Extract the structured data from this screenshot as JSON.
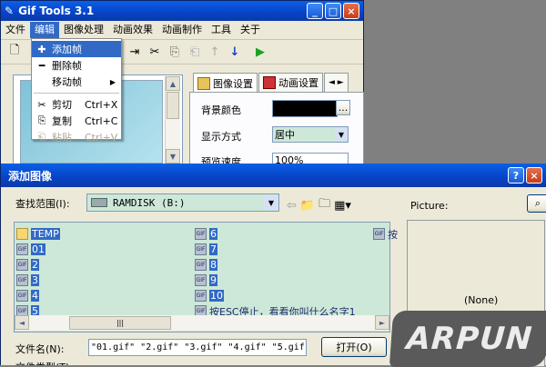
{
  "main_window": {
    "title": "Gif Tools 3.1",
    "controls": {
      "minimize": "_",
      "maximize": "□",
      "close": "×"
    },
    "menu": [
      "文件",
      "编辑",
      "图像处理",
      "动画效果",
      "动画制作",
      "工具",
      "关于"
    ],
    "active_menu_index": 1,
    "edit_menu": {
      "items": [
        {
          "label": "添加帧",
          "icon": "add-frame-icon",
          "highlighted": true
        },
        {
          "label": "删除帧",
          "icon": "delete-frame-icon"
        },
        {
          "label": "移动帧",
          "submenu": true
        },
        {
          "label": "剪切",
          "shortcut": "Ctrl+X",
          "icon": "scissors-icon"
        },
        {
          "label": "复制",
          "shortcut": "Ctrl+C",
          "icon": "copy-icon"
        },
        {
          "label": "粘贴",
          "shortcut": "Ctrl+V",
          "icon": "paste-icon",
          "disabled": true
        }
      ]
    },
    "tabs": [
      {
        "label": "图像设置",
        "selected": true
      },
      {
        "label": "动画设置"
      }
    ],
    "properties": {
      "bg_color_label": "背景颜色",
      "bg_color_value": "#000000",
      "bg_color_more": "...",
      "display_mode_label": "显示方式",
      "display_mode_value": "居中",
      "preview_speed_label": "预览速度",
      "preview_speed_value": "100%"
    }
  },
  "dialog": {
    "title": "添加图像",
    "help": "?",
    "close": "×",
    "look_in_label": "查找范围(I):",
    "look_in_value": "RAMDISK (B:)",
    "preview_label": "Picture:",
    "preview_empty": "(None)",
    "files_col1": [
      {
        "name": "TEMP",
        "type": "folder"
      },
      {
        "name": "01",
        "type": "gif"
      },
      {
        "name": "2",
        "type": "gif"
      },
      {
        "name": "3",
        "type": "gif"
      },
      {
        "name": "4",
        "type": "gif"
      },
      {
        "name": "5",
        "type": "gif"
      }
    ],
    "files_col2": [
      {
        "name": "6",
        "type": "gif"
      },
      {
        "name": "7",
        "type": "gif"
      },
      {
        "name": "8",
        "type": "gif"
      },
      {
        "name": "9",
        "type": "gif"
      },
      {
        "name": "10",
        "type": "gif"
      },
      {
        "name": "按ESC停止，看看你叫什么名字1",
        "type": "gif"
      }
    ],
    "files_col3": [
      {
        "name": "按",
        "type": "gif"
      }
    ],
    "filename_label": "文件名(N):",
    "filename_value": "\"01.gif\" \"2.gif\" \"3.gif\" \"4.gif\" \"5.gif",
    "open_button": "打开(O)",
    "filetype_label": "文件类型(T):"
  },
  "watermark": "ARPUN",
  "colors": {
    "titlebar": "#0a4fd8",
    "highlight": "#316ac5",
    "list_bg": "#cde8d8"
  }
}
